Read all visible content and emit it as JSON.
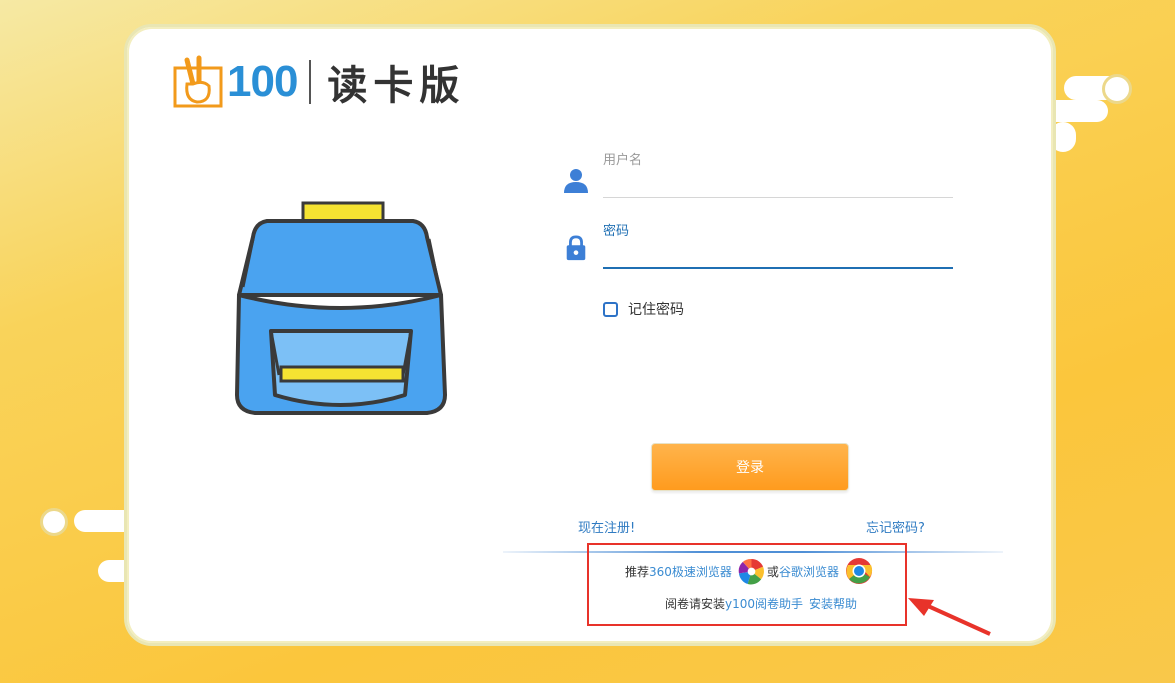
{
  "logo": {
    "number": "100",
    "product": "读卡版"
  },
  "form": {
    "username_label": "用户名",
    "password_label": "密码",
    "remember_label": "记住密码",
    "login_label": "登录"
  },
  "links": {
    "register": "现在注册!",
    "forgot": "忘记密码?"
  },
  "recommend": {
    "prefix": "推荐",
    "browser1": "360极速浏览器",
    "or": "或",
    "browser2": "谷歌浏览器",
    "install_prefix": "阅卷请安装",
    "helper": "y100阅卷助手",
    "install_help": "安装帮助"
  },
  "colors": {
    "accent_blue": "#1f6fb3",
    "button_orange": "#ff9b1e",
    "highlight_red": "#e8332a"
  }
}
